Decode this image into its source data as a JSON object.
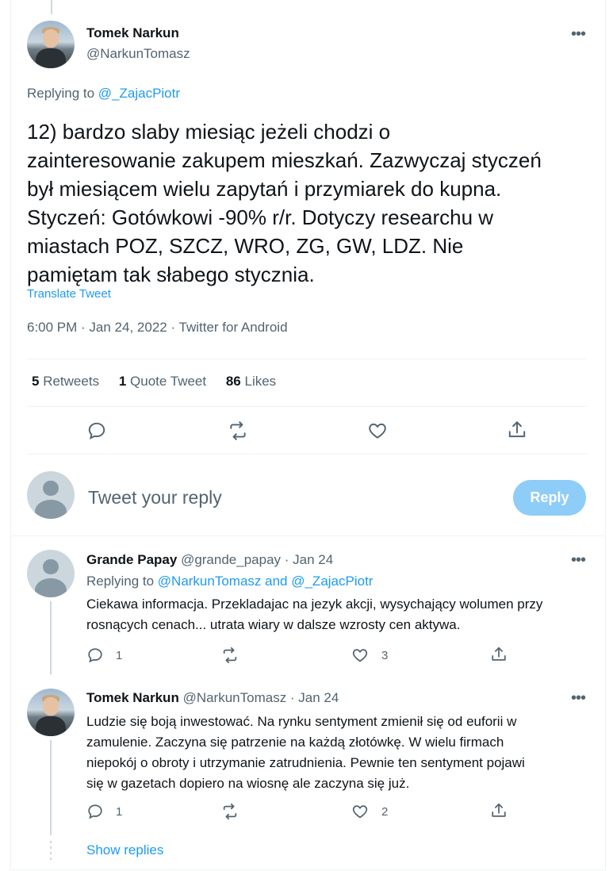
{
  "main_tweet": {
    "author_name": "Tomek Narkun",
    "author_handle": "@NarkunTomasz",
    "replying_label": "Replying to ",
    "replying_to": "@_ZajacPiotr",
    "text_lines": [
      "12) bardzo slaby miesiąc jeżeli chodzi o",
      "zainteresowanie zakupem mieszkań. Zazwyczaj styczeń",
      "był miesiącem wielu zapytań i przymiarek do kupna.",
      "Styczeń: Gotówkowi -90% r/r. Dotyczy researchu w",
      "miastach POZ, SZCZ, WRO, ZG, GW, LDZ. Nie",
      "pamiętam tak słabego stycznia."
    ],
    "translate": "Translate Tweet",
    "timestamp": "6:00 PM · Jan 24, 2022 · Twitter for Android",
    "stats": {
      "retweets_count": "5",
      "retweets_label": "Retweets",
      "quotes_count": "1",
      "quotes_label": "Quote Tweet",
      "likes_count": "86",
      "likes_label": "Likes"
    }
  },
  "compose": {
    "placeholder": "Tweet your reply",
    "button": "Reply"
  },
  "replies": [
    {
      "name": "Grande Papay",
      "meta": "@grande_papay · Jan 24",
      "replying_label": "Replying to ",
      "replying_to": "@NarkunTomasz and @_ZajacPiotr",
      "text_lines": [
        "Ciekawa informacja. Przekladajac na jezyk akcji, wysychający wolumen przy",
        "rosnących cenach... utrata wiary w dalsze wzrosty cen aktywa."
      ],
      "reply_count": "1",
      "like_count": "3"
    },
    {
      "name": "Tomek Narkun",
      "meta": "@NarkunTomasz · Jan 24",
      "text_lines": [
        "Ludzie się boją inwestować. Na rynku sentyment zmienił się od euforii w",
        "zamulenie. Zaczyna się patrzenie na każdą złotówkę. W wielu firmach",
        "niepokój o obroty i utrzymanie zatrudnienia. Pewnie ten sentyment pojawi",
        "się w gazetach dopiero na wiosnę ale zaczyna się już."
      ],
      "reply_count": "1",
      "like_count": "2"
    }
  ],
  "show_replies": "Show replies"
}
